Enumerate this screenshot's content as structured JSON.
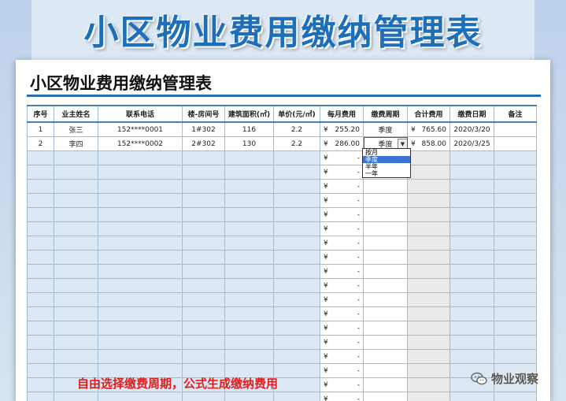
{
  "banner": {
    "title": "小区物业费用缴纳管理表"
  },
  "sheet": {
    "title": "小区物业费用缴纳管理表"
  },
  "table": {
    "headers": [
      "序号",
      "业主姓名",
      "联系电话",
      "楼-房间号",
      "建筑面积(㎡)",
      "单价(元/㎡)",
      "每月费用",
      "缴费周期",
      "合计费用",
      "缴费日期",
      "备注"
    ],
    "currency": "¥",
    "rows": [
      {
        "no": "1",
        "name": "张三",
        "phone": "152****0001",
        "room": "1#302",
        "area": "116",
        "price": "2.2",
        "monthly": "255.20",
        "cycle": "季度",
        "total": "765.60",
        "date": "2020/3/20",
        "note": ""
      },
      {
        "no": "2",
        "name": "李四",
        "phone": "152****0002",
        "room": "2#302",
        "area": "130",
        "price": "2.2",
        "monthly": "286.00",
        "cycle": "季度",
        "total": "858.00",
        "date": "2020/3/25",
        "note": ""
      }
    ],
    "empty_fee": "-"
  },
  "dropdown": {
    "options": [
      "按月",
      "季度",
      "半年",
      "一年"
    ],
    "selected": "季度"
  },
  "annotation": "自由选择缴费周期，公式生成缴纳费用",
  "watermark": {
    "text": "物业观察"
  },
  "colors": {
    "banner_text": "#1d6fb9",
    "header_rule": "#2e6ea8",
    "empty_row": "#dde8f5",
    "annotation": "#e11d1d",
    "selection": "#3a74d2"
  }
}
